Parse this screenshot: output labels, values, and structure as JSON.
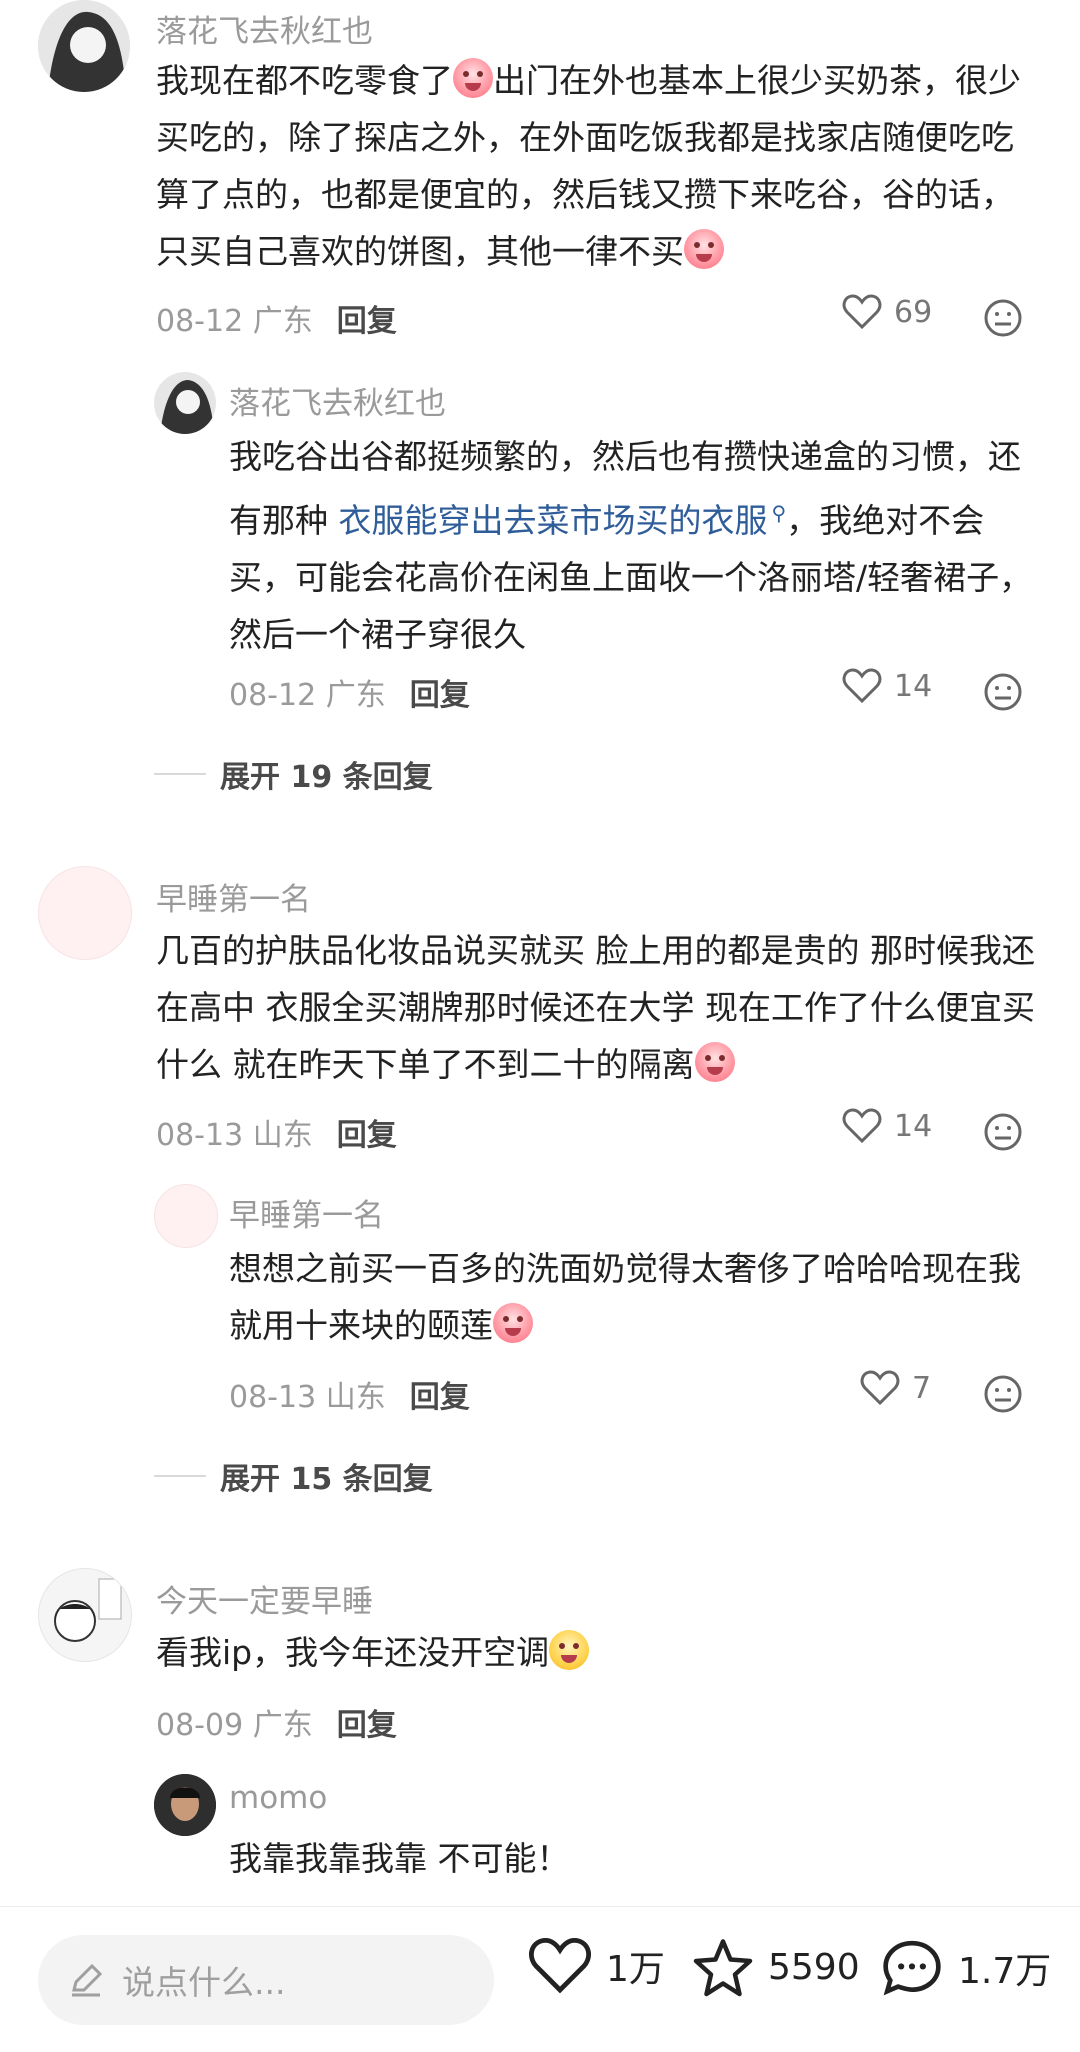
{
  "comments": [
    {
      "user": "落花飞去秋红也",
      "text_part1": "我现在都不吃零食了",
      "text_part2": "出门在外也基本上很少买奶茶，很少买吃的，除了探店之外，在外面吃饭我都是找家店随便吃吃算了点的，也都是便宜的，然后钱又攒下来吃谷，谷的话，只买自己喜欢的饼图，其他一律不买",
      "date_loc": "08-12 广东",
      "reply": "回复",
      "likes": "69",
      "sub": {
        "user": "落花飞去秋红也",
        "text_part1": "我吃谷出谷都挺频繁的，然后也有攒快递盒的习惯，还有那种 ",
        "link": "衣服能穿出去菜市场买的衣服",
        "text_part2": "，我绝对不会买，可能会花高价在闲鱼上面收一个洛丽塔/轻奢裙子，然后一个裙子穿很久",
        "date_loc": "08-12 广东",
        "reply": "回复",
        "likes": "14"
      },
      "expand": "展开 19 条回复"
    },
    {
      "user": "早睡第一名",
      "text": "几百的护肤品化妆品说买就买 脸上用的都是贵的 那时候我还在高中 衣服全买潮牌那时候还在大学 现在工作了什么便宜买什么 就在昨天下单了不到二十的隔离",
      "date_loc": "08-13 山东",
      "reply": "回复",
      "likes": "14",
      "sub": {
        "user": "早睡第一名",
        "text": "想想之前买一百多的洗面奶觉得太奢侈了哈哈哈现在我就用十来块的颐莲",
        "date_loc": "08-13 山东",
        "reply": "回复",
        "likes": "7"
      },
      "expand": "展开 15 条回复"
    },
    {
      "user": "今天一定要早睡",
      "text": "看我ip，我今年还没开空调",
      "date_loc": "08-09 广东",
      "reply": "回复",
      "sub": {
        "user": "momo",
        "text": "我靠我靠我靠 不可能！"
      }
    }
  ],
  "bottom": {
    "placeholder": "说点什么...",
    "likes": "1万",
    "stars": "5590",
    "comments": "1.7万"
  },
  "icons": [
    "heart-icon",
    "face-icon",
    "pencil-icon",
    "star-icon",
    "chat-icon"
  ]
}
